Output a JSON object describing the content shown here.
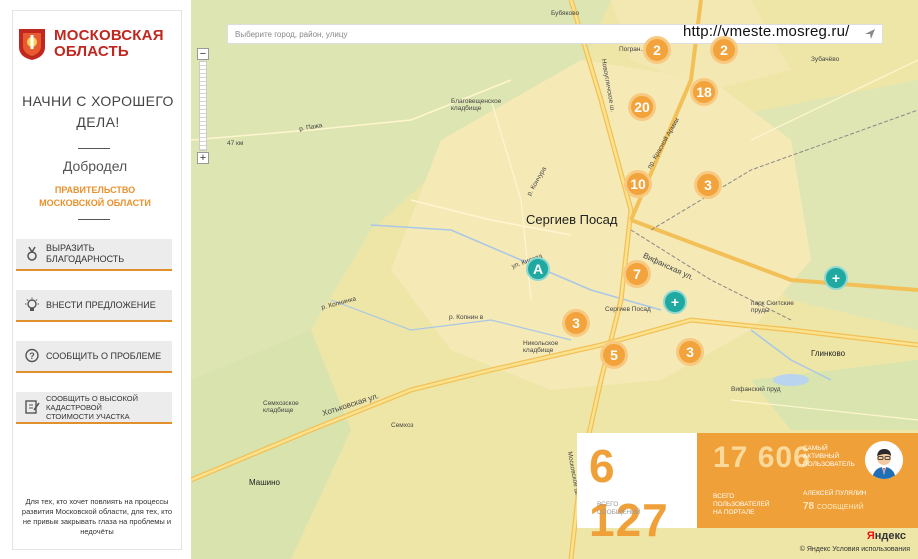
{
  "sidebar": {
    "logo_line1": "МОСКОВСКАЯ",
    "logo_line2": "ОБЛАСТЬ",
    "slogan_line1": "НАЧНИ С ХОРОШЕГО",
    "slogan_line2": "ДЕЛА!",
    "dobrodel": "Добродел",
    "gov_line1": "ПРАВИТЕЛЬСТВО",
    "gov_line2": "МОСКОВСКОЙ ОБЛАСТИ",
    "actions": [
      {
        "label": "ВЫРАЗИТЬ БЛАГОДАРНОСТЬ",
        "icon": "medal-icon"
      },
      {
        "label": "ВНЕСТИ ПРЕДЛОЖЕНИЕ",
        "icon": "lightbulb-icon"
      },
      {
        "label": "СООБЩИТЬ О ПРОБЛЕМЕ",
        "icon": "question-bubble-icon"
      },
      {
        "label_line1": "СООБЩИТЬ О ВЫСОКОЙ КАДАСТРОВОЙ",
        "label_line2": "СТОИМОСТИ УЧАСТКА",
        "icon": "document-edit-icon"
      }
    ],
    "footnote": "Для тех, кто хочет повлиять на процессы развития Московской области, для тех, кто не привык закрывать глаза на проблемы и недочёты"
  },
  "map": {
    "search_placeholder": "Выберите город, район, улицу",
    "url": "http://vmeste.mosreg.ru/",
    "city": "Сергиев Посад",
    "clusters": [
      "2",
      "2",
      "20",
      "18",
      "10",
      "3",
      "7",
      "3",
      "5",
      "3"
    ],
    "labels": {
      "glinkovo": "Глинково",
      "mashino": "Машино",
      "zubachevo": "Зубачёво",
      "bubyakovo": "Бубяково",
      "sergiev_station": "Сергиев Посад",
      "khotkovskaya": "Хотьковская ул.",
      "kirova": "ул. Кирова",
      "kopnino": "р. Копнин в",
      "kopninka": "р. Копнинка",
      "koncha": "р. Кончура",
      "pazha": "р. Пажа",
      "vifanskaya": "Вифанская ул.",
      "krasnoy_armii": "пр. Красной Армии",
      "novouglichskoe": "Новоугличское ш.",
      "moskovskoe": "Московское ш.",
      "blagoveshchenskoe": "Благовещенское кладбище",
      "nikolskoe": "Никольское кладбище",
      "semkhozskoe": "Семхозское кладбище",
      "park": "парк Скитские пруды",
      "vifanskiy_prud": "Вифанский пруд",
      "semkhoz": "Семхоз",
      "km": "47 км",
      "pogranichnaya": "Погран... ул."
    },
    "yandex_a": "Я",
    "yandex_b": "ндекс",
    "terms": "© Яндекс   Условия использования"
  },
  "stats": {
    "messages_count": "6 127",
    "messages_caption_1": "ВСЕГО",
    "messages_caption_2": "СООБЩЕНИЙ",
    "users_count": "17 606",
    "users_caption_1": "ВСЕГО",
    "users_caption_2": "ПОЛЬЗОВАТЕЛЕЙ",
    "users_caption_3": "НА ПОРТАЛЕ",
    "active_1": "САМЫЙ",
    "active_2": "АКТИВНЫЙ",
    "active_3": "ПОЛЬЗОВАТЕЛЬ",
    "active_user_name": "АЛЕКСЕЙ ПУЛЯЛИН",
    "active_user_count": "78",
    "active_user_unit": "СООБЩЕНИЙ"
  },
  "colors": {
    "brand_red": "#c0271f",
    "accent_orange": "#f0a038",
    "teal": "#1fa9a1"
  }
}
